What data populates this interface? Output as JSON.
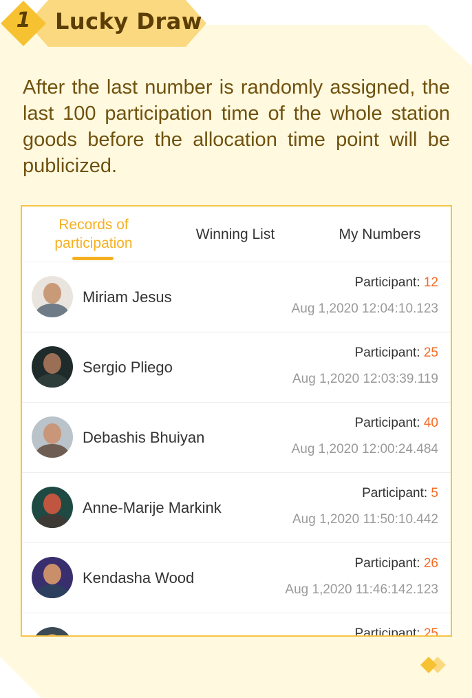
{
  "header": {
    "step_number": "1",
    "title": "Lucky Draw"
  },
  "description": "After the last number is randomly assigned, the last 100 participation time of the whole station goods before the allocation time point will be publicized.",
  "tabs": [
    {
      "label": "Records of participation",
      "active": true
    },
    {
      "label": "Winning List",
      "active": false
    },
    {
      "label": "My Numbers",
      "active": false
    }
  ],
  "participant_label": "Participant: ",
  "records": [
    {
      "name": "Miriam Jesus",
      "count": "12",
      "time": "Aug 1,2020 12:04:10.123"
    },
    {
      "name": "Sergio Pliego",
      "count": "25",
      "time": "Aug 1,2020 12:03:39.119"
    },
    {
      "name": "Debashis Bhuiyan",
      "count": "40",
      "time": "Aug 1,2020 12:00:24.484"
    },
    {
      "name": "Anne-Marije Markink",
      "count": "5",
      "time": "Aug 1,2020 11:50:10.442"
    },
    {
      "name": "Kendasha Wood",
      "count": "26",
      "time": "Aug 1,2020 11:46:142.123"
    },
    {
      "name": "",
      "count": "25",
      "time": ""
    }
  ],
  "colors": {
    "accent": "#f5b021",
    "count": "#f56a22",
    "title": "#5b3d06",
    "body_text": "#70520f",
    "card_border": "#f5c444",
    "background": "#fff9df"
  }
}
